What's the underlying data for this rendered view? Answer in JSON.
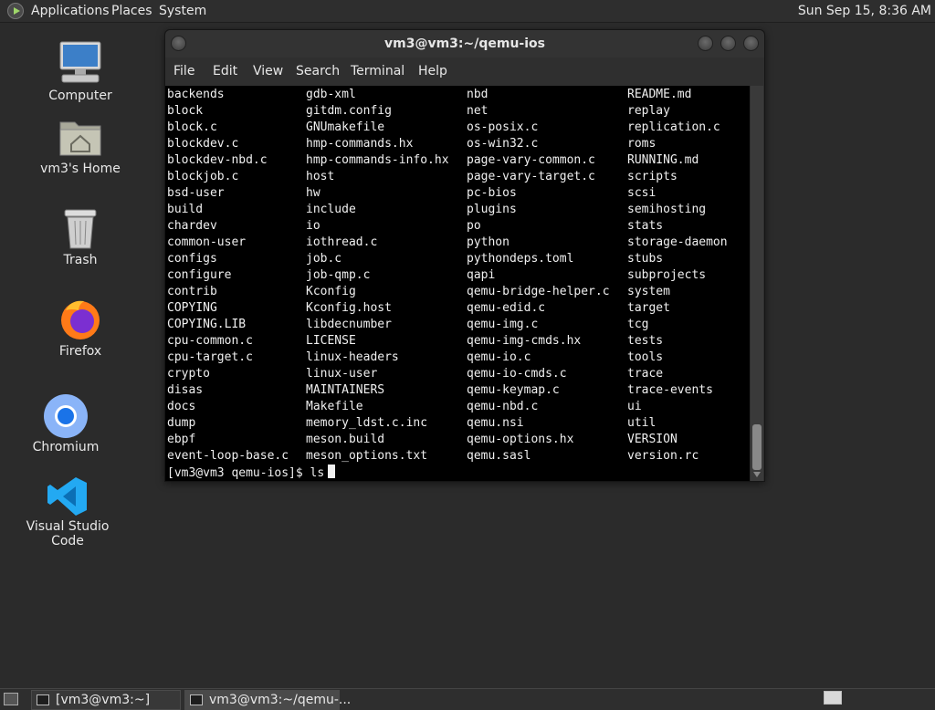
{
  "top_panel": {
    "menus": [
      "Applications",
      "Places",
      "System"
    ],
    "clock": "Sun Sep 15,  8:36 AM"
  },
  "desktop_icons": [
    {
      "label": "Computer",
      "icon": "computer-icon"
    },
    {
      "label": "vm3's Home",
      "icon": "home-folder-icon"
    },
    {
      "label": "Trash",
      "icon": "trash-icon"
    },
    {
      "label": "Firefox",
      "icon": "firefox-icon"
    },
    {
      "label": "Chromium",
      "icon": "chromium-icon"
    },
    {
      "label": "Visual Studio Code",
      "icon": "vscode-icon"
    }
  ],
  "terminal": {
    "title": "vm3@vm3:~/qemu-ios",
    "menu": [
      "File",
      "Edit",
      "View",
      "Search",
      "Terminal",
      "Help"
    ],
    "columns": [
      [
        "backends",
        "block",
        "block.c",
        "blockdev.c",
        "blockdev-nbd.c",
        "blockjob.c",
        "bsd-user",
        "build",
        "chardev",
        "common-user",
        "configs",
        "configure",
        "contrib",
        "COPYING",
        "COPYING.LIB",
        "cpu-common.c",
        "cpu-target.c",
        "crypto",
        "disas",
        "docs",
        "dump",
        "ebpf",
        "event-loop-base.c"
      ],
      [
        "gdb-xml",
        "gitdm.config",
        "GNUmakefile",
        "hmp-commands.hx",
        "hmp-commands-info.hx",
        "host",
        "hw",
        "include",
        "io",
        "iothread.c",
        "job.c",
        "job-qmp.c",
        "Kconfig",
        "Kconfig.host",
        "libdecnumber",
        "LICENSE",
        "linux-headers",
        "linux-user",
        "MAINTAINERS",
        "Makefile",
        "memory_ldst.c.inc",
        "meson.build",
        "meson_options.txt"
      ],
      [
        "nbd",
        "net",
        "os-posix.c",
        "os-win32.c",
        "page-vary-common.c",
        "page-vary-target.c",
        "pc-bios",
        "plugins",
        "po",
        "python",
        "pythondeps.toml",
        "qapi",
        "qemu-bridge-helper.c",
        "qemu-edid.c",
        "qemu-img.c",
        "qemu-img-cmds.hx",
        "qemu-io.c",
        "qemu-io-cmds.c",
        "qemu-keymap.c",
        "qemu-nbd.c",
        "qemu.nsi",
        "qemu-options.hx",
        "qemu.sasl"
      ],
      [
        "README.md",
        "replay",
        "replication.c",
        "roms",
        "RUNNING.md",
        "scripts",
        "scsi",
        "semihosting",
        "stats",
        "storage-daemon",
        "stubs",
        "subprojects",
        "system",
        "target",
        "tcg",
        "tests",
        "tools",
        "trace",
        "trace-events",
        "ui",
        "util",
        "VERSION",
        "version.rc"
      ]
    ],
    "prompt": "[vm3@vm3 qemu-ios]$ ls"
  },
  "taskbar": {
    "tasks": [
      "[vm3@vm3:~]",
      "vm3@vm3:~/qemu-..."
    ]
  }
}
